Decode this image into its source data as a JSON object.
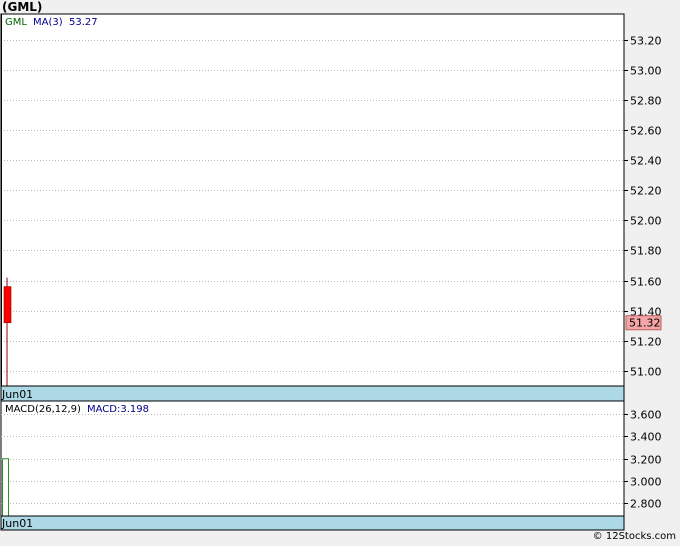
{
  "page": {
    "title": "(GML)",
    "footer": "© 12Stocks.com"
  },
  "colors": {
    "background": "#ffffff",
    "frame": "#f0f0f0",
    "date_band": "#add8e6",
    "grid": "#b8b8b8",
    "candle_down": "#ff0000",
    "last_price_box": "#f4a6a6",
    "macd_bar": "#2e8b2e",
    "ticker_text": "#006400",
    "ma_text": "#00008b"
  },
  "chart_data": [
    {
      "type": "candlestick",
      "ticker_label": "GML",
      "indicator_label": "MA(3)",
      "indicator_value": "53.27",
      "x": [
        "Jun01"
      ],
      "x_tick_labels": [
        "Jun01"
      ],
      "ylim": [
        50.9,
        53.37
      ],
      "y_ticks": [
        51.0,
        51.2,
        51.4,
        51.6,
        51.8,
        52.0,
        52.2,
        52.4,
        52.6,
        52.8,
        53.0,
        53.2
      ],
      "y_tick_labels": [
        "51.00",
        "51.20",
        "51.40",
        "51.60",
        "51.80",
        "52.00",
        "52.20",
        "52.40",
        "52.60",
        "52.80",
        "53.00",
        "53.20"
      ],
      "candles": [
        {
          "date": "Jun01",
          "open": 51.56,
          "high": 51.62,
          "low": 50.9,
          "close": 51.32
        }
      ],
      "last_price": 51.32,
      "last_price_label": "51.32",
      "grid": true
    },
    {
      "type": "bar",
      "indicator_label": "MACD(26,12,9)",
      "macd_label": "MACD:3.198",
      "x": [
        "Jun01"
      ],
      "x_tick_labels": [
        "Jun01"
      ],
      "values": [
        3.198
      ],
      "ylim": [
        2.68,
        3.72
      ],
      "y_ticks": [
        2.8,
        3.0,
        3.2,
        3.4,
        3.6
      ],
      "y_tick_labels": [
        "2.800",
        "3.000",
        "3.200",
        "3.400",
        "3.600"
      ],
      "grid": true
    }
  ]
}
